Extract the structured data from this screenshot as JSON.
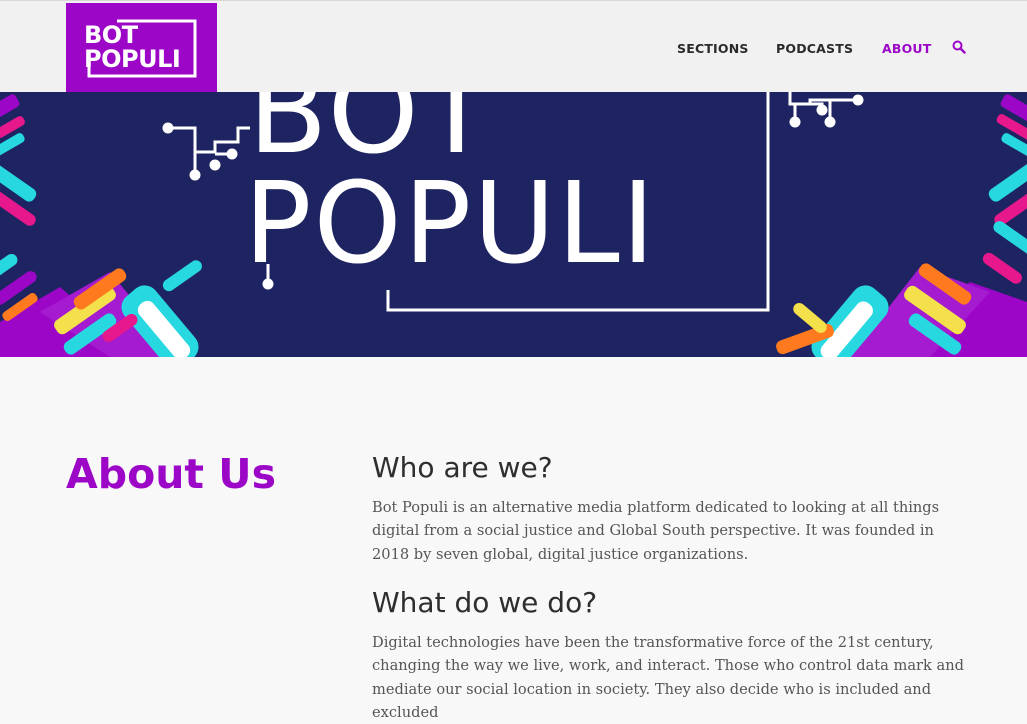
{
  "header": {
    "logo": {
      "line1": "BOT",
      "line2": "POPULI"
    },
    "nav": [
      {
        "label": "SECTIONS",
        "active": false
      },
      {
        "label": "PODCASTS",
        "active": false
      },
      {
        "label": "ABOUT",
        "active": true
      }
    ],
    "search_icon": "search-icon"
  },
  "banner": {
    "line1": "BOT",
    "line2": "POPULI"
  },
  "colors": {
    "brand": "#9c07c7",
    "banner_bg": "#1e2462",
    "cyan": "#28d8e0",
    "orange": "#ff7a1e",
    "yellow": "#f4e04a",
    "magenta": "#e6188c"
  },
  "main": {
    "title": "About Us",
    "sections": [
      {
        "heading": "Who are we?",
        "body": "Bot Populi is an alternative media platform dedicated to looking at all things digital from a social justice and Global South perspective. It was founded in 2018 by seven global, digital justice organizations."
      },
      {
        "heading": "What do we do?",
        "body": "Digital technologies have been the transformative force of the 21st century, changing the way we live, work, and interact. Those who control data mark and mediate our social location in society. They also decide who is included and excluded"
      }
    ]
  }
}
